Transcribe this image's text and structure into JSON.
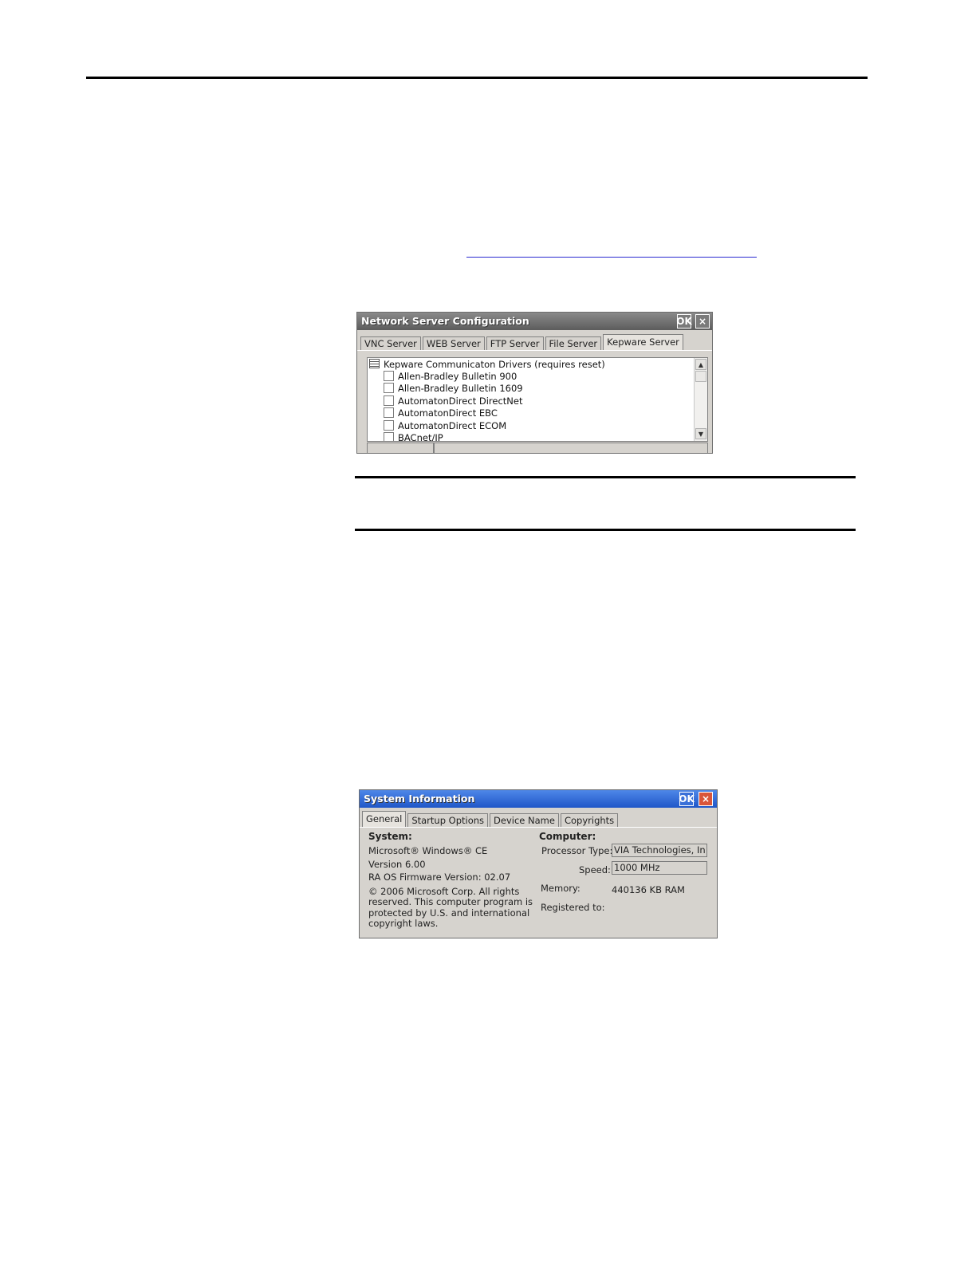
{
  "network_window": {
    "title": "Network Server Configuration",
    "ok_label": "OK",
    "close_label": "×",
    "tabs": [
      "VNC Server",
      "WEB Server",
      "FTP Server",
      "File Server",
      "Kepware Server"
    ],
    "tree_root": "Kepware Communicaton Drivers (requires reset)",
    "drivers": [
      "Allen-Bradley Bulletin 900",
      "Allen-Bradley Bulletin 1609",
      "AutomatonDirect DirectNet",
      "AutomatonDirect EBC",
      "AutomatonDirect ECOM",
      "BACnet/IP"
    ]
  },
  "system_window": {
    "title": "System Information",
    "ok_label": "OK",
    "close_label": "×",
    "tabs": [
      "General",
      "Startup Options",
      "Device Name",
      "Copyrights"
    ],
    "system": {
      "heading": "System:",
      "os": "Microsoft® Windows® CE",
      "version": "Version 6.00",
      "firmware": "RA OS Firmware Version: 02.07",
      "copyright_lines": [
        "© 2006 Microsoft Corp. All rights",
        "reserved. This computer program is",
        "protected by U.S. and international",
        "copyright laws."
      ]
    },
    "computer": {
      "heading": "Computer:",
      "processor_label": "Processor Type:",
      "processor_value": "VIA Technologies, In",
      "speed_label": "Speed:",
      "speed_value": "1000 MHz",
      "memory_label": "Memory:",
      "memory_value": "440136 KB  RAM",
      "registered_label": "Registered to:"
    }
  }
}
